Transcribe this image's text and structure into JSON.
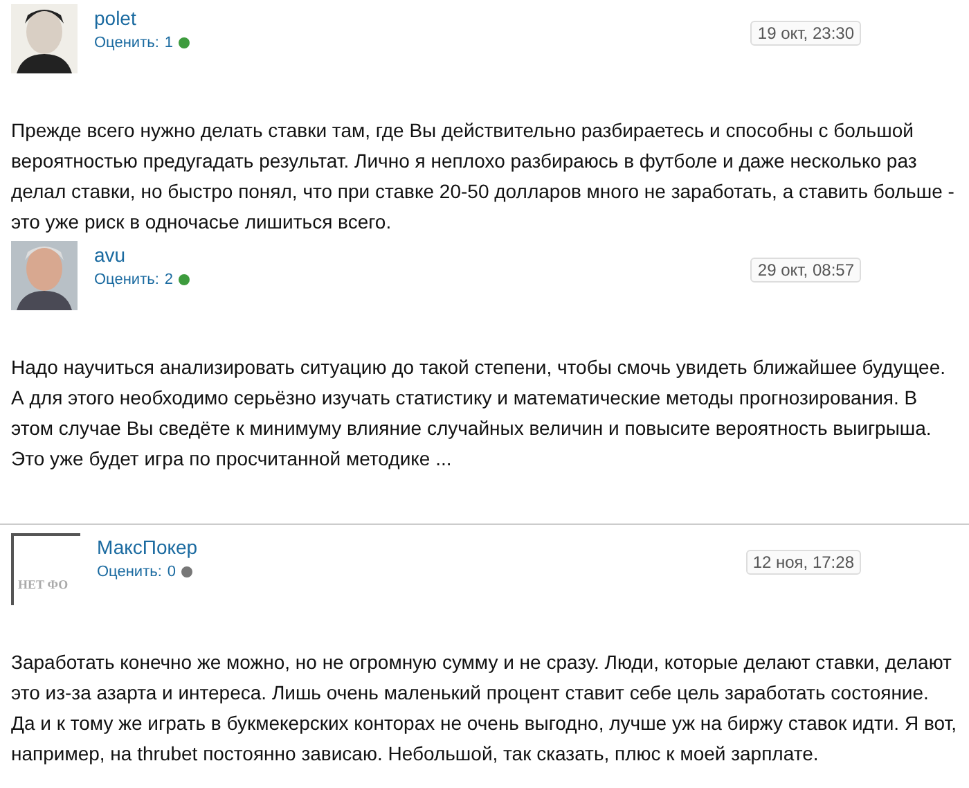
{
  "posts": [
    {
      "author": "polet",
      "kind": "picture",
      "rating_label": "Оценить:",
      "rating": "1",
      "color": "#3d9b3d",
      "date": "19 окт, 23:30",
      "separated": false,
      "text": "Прежде всего нужно делать ставки там, где Вы действительно разбираетесь и способны с большой вероятностью предугадать результат. Лично я неплохо разбираюсь в футболе и даже несколько раз делал ставки, но быстро понял, что при ставке 20-50 долларов много не заработать, а ставить больше - это уже риск в одночасье лишиться всего."
    },
    {
      "author": "avu",
      "kind": "picture",
      "rating_label": "Оценить:",
      "rating": "2",
      "color": "#3d9b3d",
      "date": "29 окт, 08:57",
      "separated": false,
      "text": "Надо научиться анализировать ситуацию до такой степени, чтобы смочь увидеть ближайшее будущее. А для этого необходимо серьёзно изучать статистику и математические методы прогнозирования. В этом случае Вы сведёте к минимуму влияние случайных величин и повысите вероятность выигрыша. Это уже будет игра по просчитанной методике ..."
    },
    {
      "author": "МаксПокер",
      "kind": "placeholder",
      "avatar_text": "НЕТ ФО",
      "rating_label": "Оценить:",
      "rating": "0",
      "color": "#777777",
      "date": "12 ноя, 17:28",
      "separated": true,
      "text": "Заработать конечно же можно, но не огромную сумму и не сразу. Люди, которые делают ставки, делают это из-за азарта и интереса. Лишь очень маленький процент ставит себе цель заработать состояние. Да и к тому же играть в букмекерских конторах не очень выгодно, лучше уж на биржу ставок идти. Я вот, например, на thrubet постоянно зависаю. Небольшой, так сказать, плюс к моей зарплате."
    }
  ]
}
